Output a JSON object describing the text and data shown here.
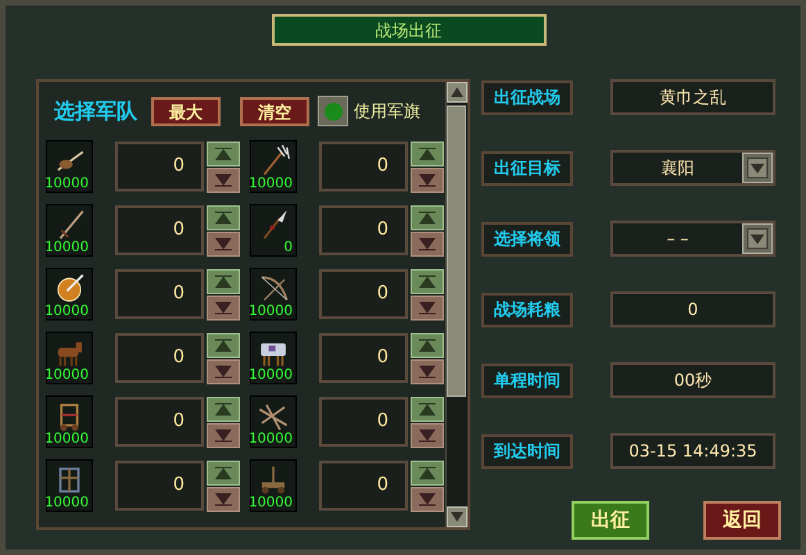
{
  "window": {
    "title": "战场出征"
  },
  "troops": {
    "title": "选择军队",
    "buttons": [
      "最大",
      "清空"
    ],
    "flag_toggle": {
      "label": "使用军旗",
      "on": true
    },
    "units": [
      {
        "count": "10000",
        "value": "0"
      },
      {
        "count": "10000",
        "value": "0"
      },
      {
        "count": "10000",
        "value": "0"
      },
      {
        "count": "0",
        "value": "0"
      },
      {
        "count": "10000",
        "value": "0"
      },
      {
        "count": "10000",
        "value": "0"
      },
      {
        "count": "10000",
        "value": "0"
      },
      {
        "count": "10000",
        "value": "0"
      },
      {
        "count": "10000",
        "value": "0"
      },
      {
        "count": "10000",
        "value": "0"
      },
      {
        "count": "10000",
        "value": "0"
      },
      {
        "count": "10000",
        "value": "0"
      }
    ]
  },
  "form": [
    {
      "label": "出征战场",
      "value": "黄巾之乱",
      "kind": "text"
    },
    {
      "label": "出征目标",
      "value": "襄阳",
      "kind": "dropdown"
    },
    {
      "label": "选择将领",
      "value": "– –",
      "kind": "dropdown"
    },
    {
      "label": "战场耗粮",
      "value": "0",
      "kind": "text"
    },
    {
      "label": "单程时间",
      "value": "00秒",
      "kind": "text"
    },
    {
      "label": "到达时间",
      "value": "03-15 14:49:35",
      "kind": "text"
    }
  ],
  "actions": [
    {
      "label": "出征",
      "kind": "confirm"
    },
    {
      "label": "返回",
      "kind": "cancel"
    }
  ]
}
